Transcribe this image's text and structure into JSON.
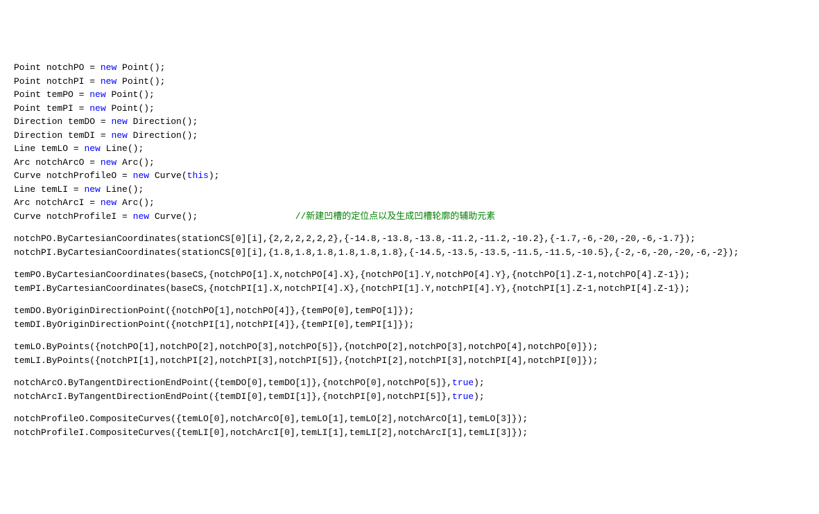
{
  "lines": [
    {
      "tokens": [
        {
          "t": "Point",
          "c": "type"
        },
        {
          "t": " notchPO = ",
          "c": "ident"
        },
        {
          "t": "new",
          "c": "kw"
        },
        {
          "t": " Point();",
          "c": "ident"
        }
      ]
    },
    {
      "tokens": [
        {
          "t": "Point",
          "c": "type"
        },
        {
          "t": " notchPI = ",
          "c": "ident"
        },
        {
          "t": "new",
          "c": "kw"
        },
        {
          "t": " Point();",
          "c": "ident"
        }
      ]
    },
    {
      "tokens": [
        {
          "t": "Point",
          "c": "type"
        },
        {
          "t": " temPO = ",
          "c": "ident"
        },
        {
          "t": "new",
          "c": "kw"
        },
        {
          "t": " Point();",
          "c": "ident"
        }
      ]
    },
    {
      "tokens": [
        {
          "t": "Point",
          "c": "type"
        },
        {
          "t": " temPI = ",
          "c": "ident"
        },
        {
          "t": "new",
          "c": "kw"
        },
        {
          "t": " Point();",
          "c": "ident"
        }
      ]
    },
    {
      "tokens": [
        {
          "t": "Direction",
          "c": "type"
        },
        {
          "t": " temDO = ",
          "c": "ident"
        },
        {
          "t": "new",
          "c": "kw"
        },
        {
          "t": " Direction();",
          "c": "ident"
        }
      ]
    },
    {
      "tokens": [
        {
          "t": "Direction",
          "c": "type"
        },
        {
          "t": " temDI = ",
          "c": "ident"
        },
        {
          "t": "new",
          "c": "kw"
        },
        {
          "t": " Direction();",
          "c": "ident"
        }
      ]
    },
    {
      "tokens": [
        {
          "t": "Line",
          "c": "type"
        },
        {
          "t": " temLO = ",
          "c": "ident"
        },
        {
          "t": "new",
          "c": "kw"
        },
        {
          "t": " Line();",
          "c": "ident"
        }
      ]
    },
    {
      "tokens": [
        {
          "t": "Arc",
          "c": "type"
        },
        {
          "t": " notchArcO = ",
          "c": "ident"
        },
        {
          "t": "new",
          "c": "kw"
        },
        {
          "t": " Arc();",
          "c": "ident"
        }
      ]
    },
    {
      "tokens": [
        {
          "t": "Curve",
          "c": "type"
        },
        {
          "t": " notchProfileO = ",
          "c": "ident"
        },
        {
          "t": "new",
          "c": "kw"
        },
        {
          "t": " Curve(",
          "c": "ident"
        },
        {
          "t": "this",
          "c": "kw"
        },
        {
          "t": ");",
          "c": "ident"
        }
      ]
    },
    {
      "tokens": [
        {
          "t": "Line",
          "c": "type"
        },
        {
          "t": " temLI = ",
          "c": "ident"
        },
        {
          "t": "new",
          "c": "kw"
        },
        {
          "t": " Line();",
          "c": "ident"
        }
      ]
    },
    {
      "tokens": [
        {
          "t": "Arc",
          "c": "type"
        },
        {
          "t": " notchArcI = ",
          "c": "ident"
        },
        {
          "t": "new",
          "c": "kw"
        },
        {
          "t": " Arc();",
          "c": "ident"
        }
      ]
    },
    {
      "tokens": [
        {
          "t": "Curve",
          "c": "type"
        },
        {
          "t": " notchProfileI = ",
          "c": "ident"
        },
        {
          "t": "new",
          "c": "kw"
        },
        {
          "t": " Curve();",
          "c": "ident"
        },
        {
          "t": "                  ",
          "c": "ident"
        },
        {
          "t": "//新建凹槽的定位点以及生成凹槽轮廓的辅助元素",
          "c": "comment"
        }
      ]
    },
    {
      "blank": true
    },
    {
      "tokens": [
        {
          "t": "notchPO.ByCartesianCoordinates(stationCS[0][i],{2,2,2,2,2,2},{-14.8,-13.8,-13.8,-11.2,-11.2,-10.2},{-1.7,-6,-20,-20,-6,-1.7});",
          "c": "ident"
        }
      ]
    },
    {
      "tokens": [
        {
          "t": "notchPI.ByCartesianCoordinates(stationCS[0][i],{1.8,1.8,1.8,1.8,1.8,1.8},{-14.5,-13.5,-13.5,-11.5,-11.5,-10.5},{-2,-6,-20,-20,-6,-2});",
          "c": "ident"
        }
      ]
    },
    {
      "blank": true
    },
    {
      "tokens": [
        {
          "t": "temPO.ByCartesianCoordinates(baseCS,{notchPO[1].X,notchPO[4].X},{notchPO[1].Y,notchPO[4].Y},{notchPO[1].Z-1,notchPO[4].Z-1});",
          "c": "ident"
        }
      ]
    },
    {
      "tokens": [
        {
          "t": "temPI.ByCartesianCoordinates(baseCS,{notchPI[1].X,notchPI[4].X},{notchPI[1].Y,notchPI[4].Y},{notchPI[1].Z-1,notchPI[4].Z-1});",
          "c": "ident"
        }
      ]
    },
    {
      "blank": true
    },
    {
      "tokens": [
        {
          "t": "temDO.ByOriginDirectionPoint({notchPO[1],notchPO[4]},{temPO[0],temPO[1]});",
          "c": "ident"
        }
      ]
    },
    {
      "tokens": [
        {
          "t": "temDI.ByOriginDirectionPoint({notchPI[1],notchPI[4]},{temPI[0],temPI[1]});",
          "c": "ident"
        }
      ]
    },
    {
      "blank": true
    },
    {
      "tokens": [
        {
          "t": "temLO.ByPoints({notchPO[1],notchPO[2],notchPO[3],notchPO[5]},{notchPO[2],notchPO[3],notchPO[4],notchPO[0]});",
          "c": "ident"
        }
      ]
    },
    {
      "tokens": [
        {
          "t": "temLI.ByPoints({notchPI[1],notchPI[2],notchPI[3],notchPI[5]},{notchPI[2],notchPI[3],notchPI[4],notchPI[0]});",
          "c": "ident"
        }
      ]
    },
    {
      "blank": true
    },
    {
      "tokens": [
        {
          "t": "notchArcO.ByTangentDirectionEndPoint({temDO[0],temDO[1]},{notchPO[0],notchPO[5]},",
          "c": "ident"
        },
        {
          "t": "true",
          "c": "bool"
        },
        {
          "t": ");",
          "c": "ident"
        }
      ]
    },
    {
      "tokens": [
        {
          "t": "notchArcI.ByTangentDirectionEndPoint({temDI[0],temDI[1]},{notchPI[0],notchPI[5]},",
          "c": "ident"
        },
        {
          "t": "true",
          "c": "bool"
        },
        {
          "t": ");",
          "c": "ident"
        }
      ]
    },
    {
      "blank": true
    },
    {
      "tokens": [
        {
          "t": "notchProfileO.CompositeCurves({temLO[0],notchArcO[0],temLO[1],temLO[2],notchArcO[1],temLO[3]});",
          "c": "ident"
        }
      ]
    },
    {
      "tokens": [
        {
          "t": "notchProfileI.CompositeCurves({temLI[0],notchArcI[0],temLI[1],temLI[2],notchArcI[1],temLI[3]});",
          "c": "ident"
        }
      ]
    }
  ]
}
